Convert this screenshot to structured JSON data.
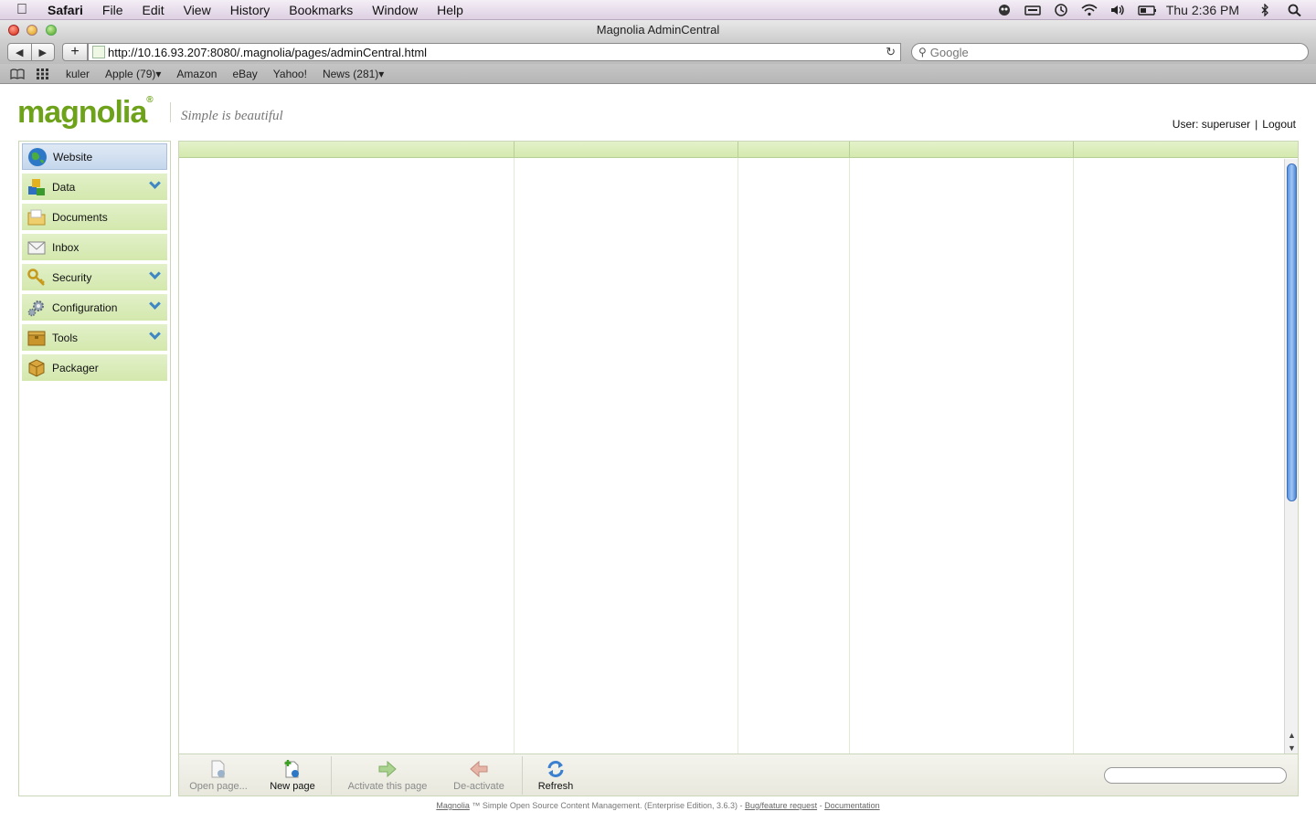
{
  "menubar": {
    "app": "Safari",
    "items": [
      "File",
      "Edit",
      "View",
      "History",
      "Bookmarks",
      "Window",
      "Help"
    ],
    "clock": "Thu 2:36 PM"
  },
  "window": {
    "title": "Magnolia AdminCentral"
  },
  "toolbar": {
    "back": "◀",
    "forward": "▶",
    "add": "+",
    "url": "http://10.16.93.207:8080/.magnolia/pages/adminCentral.html",
    "search_placeholder": "Google"
  },
  "bookmarks": [
    "kuler",
    "Apple (79)▾",
    "Amazon",
    "eBay",
    "Yahoo!",
    "News (281)▾"
  ],
  "header": {
    "logo": "magnolia",
    "tagline": "Simple is beautiful",
    "user_label": "User: superuser",
    "separator": "|",
    "logout": "Logout"
  },
  "sidebar": {
    "items": [
      {
        "label": "Website",
        "icon": "globe-icon",
        "expandable": false
      },
      {
        "label": "Data",
        "icon": "cubes-icon",
        "expandable": true
      },
      {
        "label": "Documents",
        "icon": "folder-icon",
        "expandable": false
      },
      {
        "label": "Inbox",
        "icon": "envelope-icon",
        "expandable": false
      },
      {
        "label": "Security",
        "icon": "key-icon",
        "expandable": true
      },
      {
        "label": "Configuration",
        "icon": "gear-icon",
        "expandable": true
      },
      {
        "label": "Tools",
        "icon": "toolbox-icon",
        "expandable": true
      },
      {
        "label": "Packager",
        "icon": "package-icon",
        "expandable": false
      }
    ]
  },
  "actions": [
    {
      "label": "Open page...",
      "icon": "open-page-icon",
      "enabled": false
    },
    {
      "label": "New page",
      "icon": "new-page-icon",
      "enabled": true
    },
    {
      "label": "Activate this page",
      "icon": "activate-arrow-icon",
      "enabled": false
    },
    {
      "label": "De-activate",
      "icon": "deactivate-arrow-icon",
      "enabled": false
    },
    {
      "label": "Refresh",
      "icon": "refresh-icon",
      "enabled": true
    }
  ],
  "footer": {
    "brand": "Magnolia",
    "text": " ™ Simple Open Source Content Management. (Enterprise Edition, 3.6.3) - ",
    "bug_link": "Bug/feature request",
    "dash": " - ",
    "doc_link": "Documentation"
  },
  "colors": {
    "accent_green": "#6ea21a",
    "nav_green": "#d3e8ad",
    "scroll_blue": "#5b94e0"
  }
}
